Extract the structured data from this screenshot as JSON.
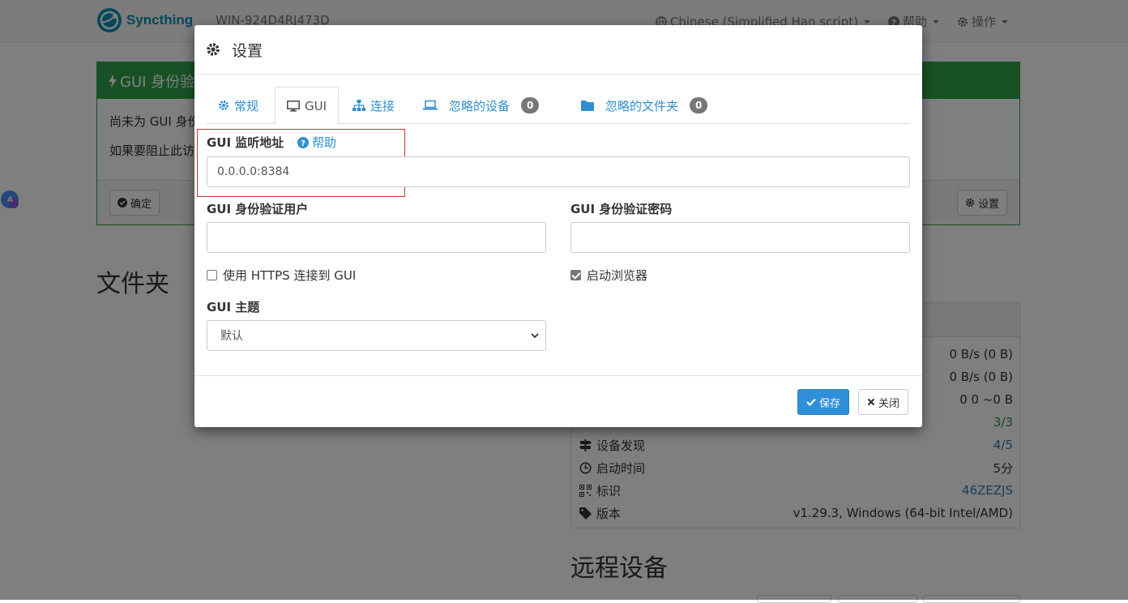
{
  "navbar": {
    "brand": "Syncthing",
    "device_name": "WIN-924D4RJ473D",
    "language": "Chinese (Simplified Han script)",
    "help": "帮助",
    "actions": "操作"
  },
  "alert": {
    "title": "GUI 身份验",
    "line1": "尚未为 GUI 身份",
    "line2": "如果要阻止此访",
    "ok_label": "确定",
    "settings_label": "设置"
  },
  "sections": {
    "folders": "文件夹",
    "remote_devices": "远程设备"
  },
  "status": {
    "rows": [
      {
        "label": "",
        "value": "0 B/s (0 B)"
      },
      {
        "label": "",
        "value": "0 B/s (0 B)"
      },
      {
        "label": "",
        "value": "0   0   ~0 B"
      },
      {
        "label": "",
        "value": "3/3"
      },
      {
        "label": "设备发现",
        "value": "4/5"
      },
      {
        "label": "启动时间",
        "value": "5分"
      },
      {
        "label": "标识",
        "value": "46ZEZJS"
      },
      {
        "label": "版本",
        "value": "v1.29.3, Windows (64-bit Intel/AMD)"
      }
    ]
  },
  "modal": {
    "title": "设置",
    "tabs": [
      {
        "label": "常规",
        "icon": "gear-icon"
      },
      {
        "label": "GUI",
        "icon": "monitor-icon"
      },
      {
        "label": "连接",
        "icon": "sitemap-icon"
      },
      {
        "label": "忽略的设备",
        "icon": "laptop-icon",
        "badge": "0"
      },
      {
        "label": "忽略的文件夹",
        "icon": "folder-icon",
        "badge": "0"
      }
    ],
    "listen_label": "GUI 监听地址",
    "help_label": "帮助",
    "listen_value": "0.0.0.0:8384",
    "user_label": "GUI 身份验证用户",
    "user_value": "",
    "password_label": "GUI 身份验证密码",
    "password_value": "",
    "https_label": "使用 HTTPS 连接到 GUI",
    "https_checked": false,
    "browser_label": "启动浏览器",
    "browser_checked": true,
    "theme_label": "GUI 主题",
    "theme_value": "默认",
    "save_label": "保存",
    "close_label": "关闭"
  },
  "colors": {
    "accent": "#2f8fd8",
    "success": "#2fa24b",
    "link": "#2f8fcf"
  }
}
